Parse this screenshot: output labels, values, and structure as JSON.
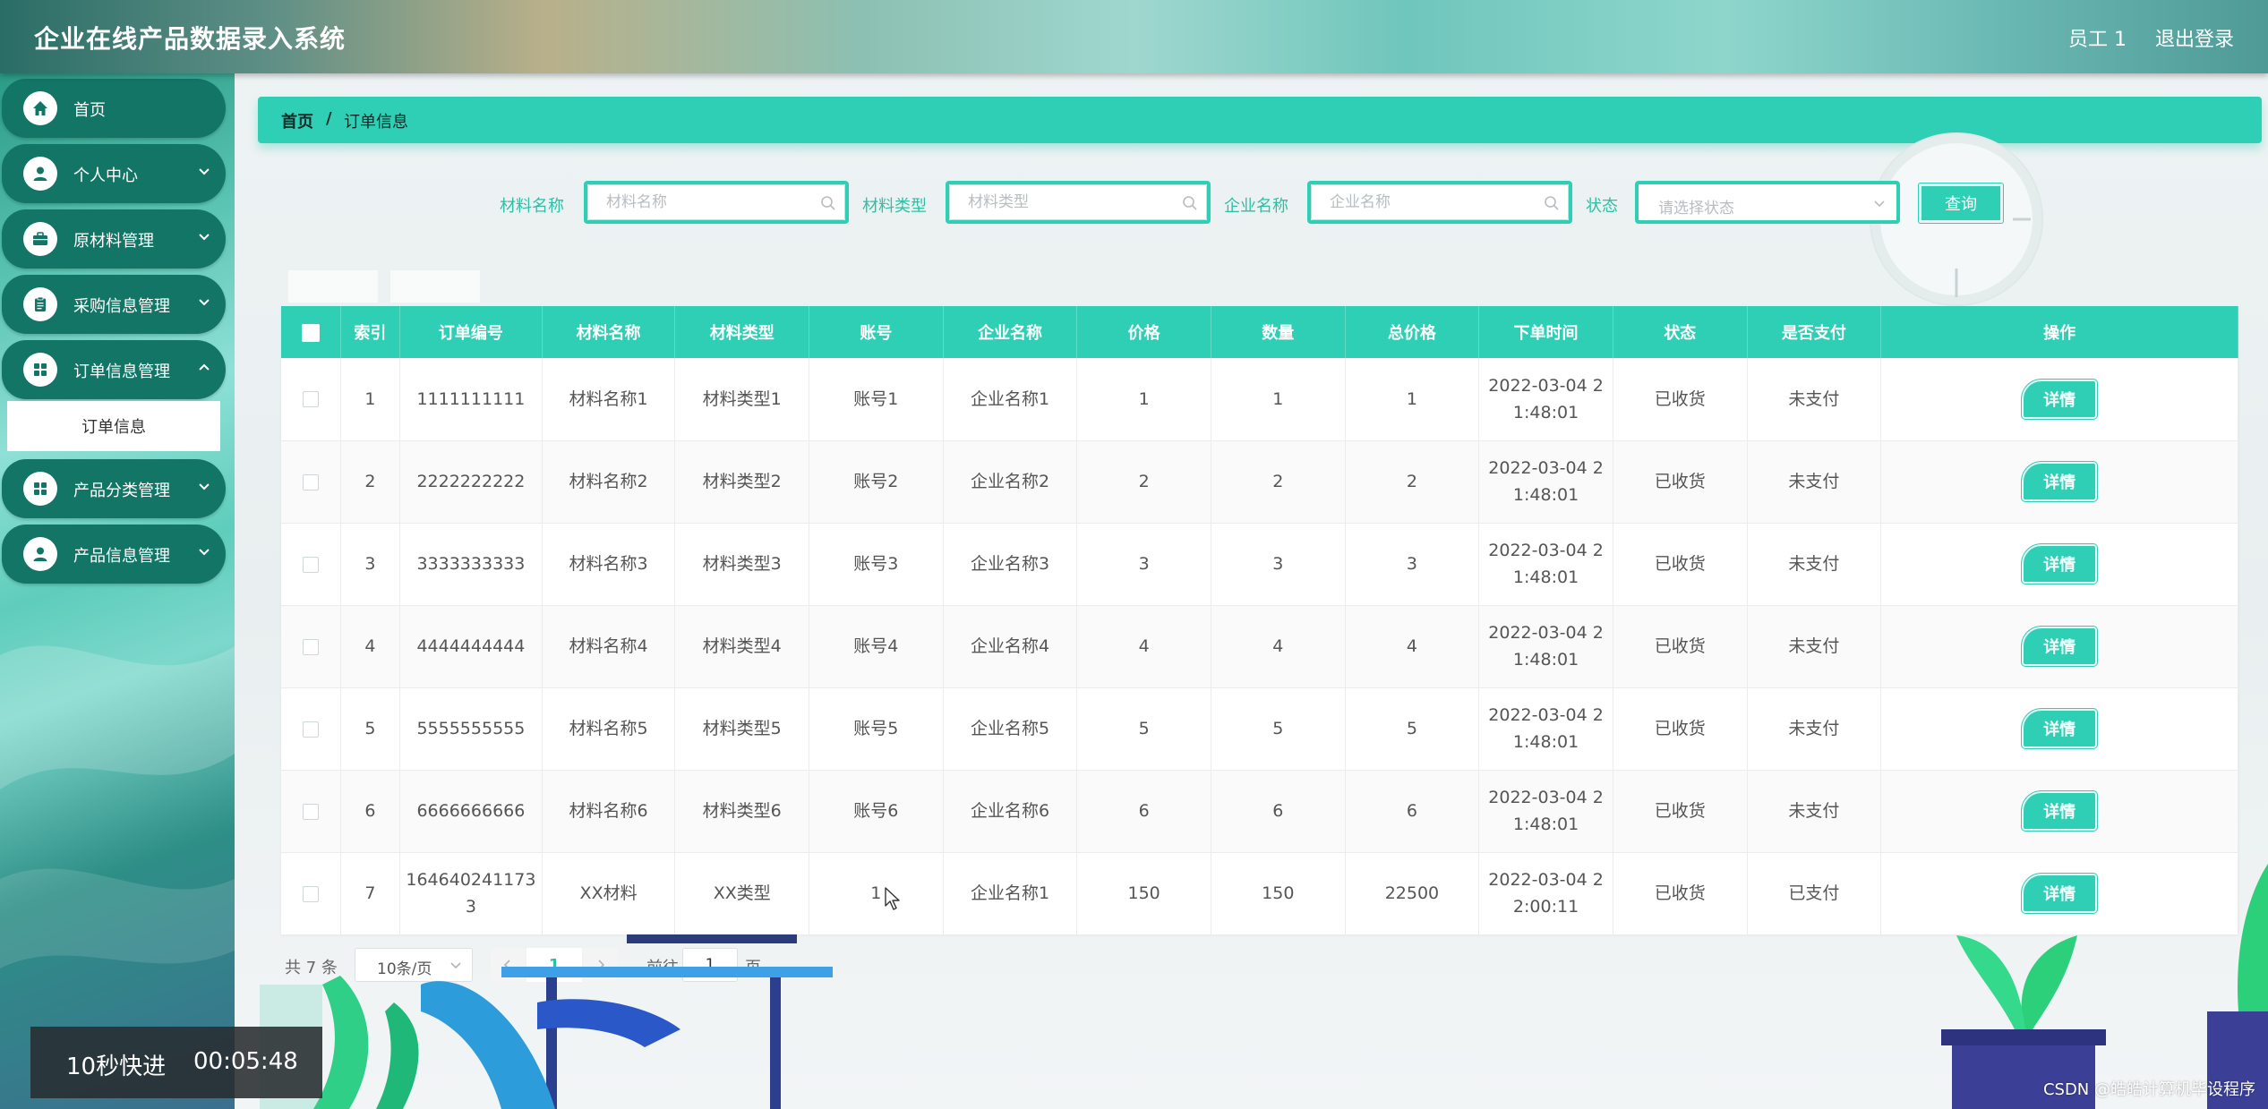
{
  "header": {
    "title": "企业在线产品数据录入系统",
    "user": "员工 1",
    "logout": "退出登录"
  },
  "sidebar": {
    "items": [
      {
        "label": "首页",
        "icon": "home-icon"
      },
      {
        "label": "个人中心",
        "icon": "user-icon"
      },
      {
        "label": "原材料管理",
        "icon": "briefcase-icon"
      },
      {
        "label": "采购信息管理",
        "icon": "clipboard-icon"
      },
      {
        "label": "订单信息管理",
        "icon": "grid-icon"
      },
      {
        "label": "产品分类管理",
        "icon": "grid-icon"
      },
      {
        "label": "产品信息管理",
        "icon": "user-icon"
      }
    ],
    "submenu": {
      "label": "订单信息"
    }
  },
  "breadcrumb": {
    "home": "首页",
    "separator": "/",
    "current": "订单信息"
  },
  "search": {
    "material_name_label": "材料名称",
    "material_name_placeholder": "材料名称",
    "material_type_label": "材料类型",
    "material_type_placeholder": "材料类型",
    "company_name_label": "企业名称",
    "company_name_placeholder": "企业名称",
    "status_label": "状态",
    "status_placeholder": "请选择状态",
    "query_button": "查询"
  },
  "table": {
    "headers": [
      "索引",
      "订单编号",
      "材料名称",
      "材料类型",
      "账号",
      "企业名称",
      "价格",
      "数量",
      "总价格",
      "下单时间",
      "状态",
      "是否支付",
      "操作"
    ],
    "detail_label": "详情",
    "rows": [
      {
        "index": "1",
        "order_no": "1111111111",
        "material_name": "材料名称1",
        "material_type": "材料类型1",
        "account": "账号1",
        "company": "企业名称1",
        "price": "1",
        "quantity": "1",
        "total": "1",
        "time": "2022-03-04 21:48:01",
        "status": "已收货",
        "paid": "未支付"
      },
      {
        "index": "2",
        "order_no": "2222222222",
        "material_name": "材料名称2",
        "material_type": "材料类型2",
        "account": "账号2",
        "company": "企业名称2",
        "price": "2",
        "quantity": "2",
        "total": "2",
        "time": "2022-03-04 21:48:01",
        "status": "已收货",
        "paid": "未支付"
      },
      {
        "index": "3",
        "order_no": "3333333333",
        "material_name": "材料名称3",
        "material_type": "材料类型3",
        "account": "账号3",
        "company": "企业名称3",
        "price": "3",
        "quantity": "3",
        "total": "3",
        "time": "2022-03-04 21:48:01",
        "status": "已收货",
        "paid": "未支付"
      },
      {
        "index": "4",
        "order_no": "4444444444",
        "material_name": "材料名称4",
        "material_type": "材料类型4",
        "account": "账号4",
        "company": "企业名称4",
        "price": "4",
        "quantity": "4",
        "total": "4",
        "time": "2022-03-04 21:48:01",
        "status": "已收货",
        "paid": "未支付"
      },
      {
        "index": "5",
        "order_no": "5555555555",
        "material_name": "材料名称5",
        "material_type": "材料类型5",
        "account": "账号5",
        "company": "企业名称5",
        "price": "5",
        "quantity": "5",
        "total": "5",
        "time": "2022-03-04 21:48:01",
        "status": "已收货",
        "paid": "未支付"
      },
      {
        "index": "6",
        "order_no": "6666666666",
        "material_name": "材料名称6",
        "material_type": "材料类型6",
        "account": "账号6",
        "company": "企业名称6",
        "price": "6",
        "quantity": "6",
        "total": "6",
        "time": "2022-03-04 21:48:01",
        "status": "已收货",
        "paid": "未支付"
      },
      {
        "index": "7",
        "order_no": "1646402411733",
        "material_name": "XX材料",
        "material_type": "XX类型",
        "account": "1",
        "company": "企业名称1",
        "price": "150",
        "quantity": "150",
        "total": "22500",
        "time": "2022-03-04 22:00:11",
        "status": "已收货",
        "paid": "已支付"
      }
    ]
  },
  "pagination": {
    "total": "共 7 条",
    "page_size": "10条/页",
    "current_page": "1",
    "goto_label": "前往",
    "goto_value": "1",
    "page_unit": "页"
  },
  "overlay": {
    "fast_forward": "10秒快进",
    "time": "00:05:48"
  },
  "watermark": "CSDN @皓皓计算机毕设程序",
  "colors": {
    "accent": "#2fcfb6",
    "sidebar_item": "#127566"
  }
}
